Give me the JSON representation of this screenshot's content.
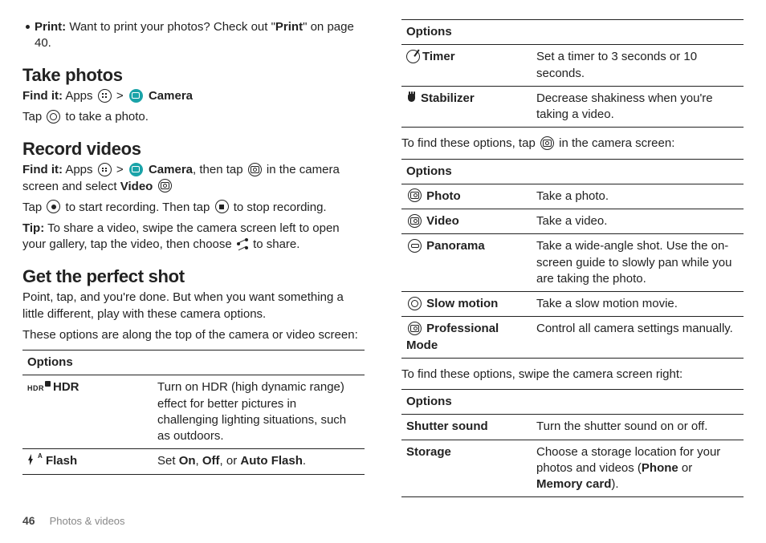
{
  "left": {
    "print_line_a": "Print:",
    "print_line_b": " Want to print your photos? Check out \"",
    "print_link": "Print",
    "print_line_c": "\" on page 40.",
    "h_take": "Take photos",
    "findit": "Find it:",
    "apps_word": " Apps ",
    "gt": " > ",
    "camera_word": " Camera",
    "tap_before": "Tap ",
    "tap_after": " to take a photo.",
    "h_record": "Record videos",
    "rec_after_cam": ", then tap ",
    "rec_tail": " in the camera screen and select ",
    "video_word": "Video",
    "rec_line2a": "Tap ",
    "rec_line2b": " to start recording. Then tap ",
    "rec_line2c": " to stop recording.",
    "tip_label": "Tip:",
    "tip_body": " To share a video, swipe the camera screen left to open your gallery, tap the video, then choose ",
    "tip_tail": " to share.",
    "h_perfect": "Get the perfect shot",
    "perfect_p1": "Point, tap, and you're done. But when you want something a little different, play with these camera options.",
    "perfect_p2": "These options are along the top of the camera or video screen:",
    "t1_header": "Options",
    "t1_r1_name": "HDR",
    "t1_r1_desc": "Turn on HDR (high dynamic range) effect for better pictures in challenging lighting situations, such as outdoors.",
    "t1_r2_name": "Flash",
    "t1_r2_desc_a": "Set ",
    "t1_r2_on": "On",
    "t1_r2_sep1": ", ",
    "t1_r2_off": "Off",
    "t1_r2_sep2": ", or ",
    "t1_r2_auto": "Auto Flash",
    "t1_r2_dot": "."
  },
  "right": {
    "t0_header": "Options",
    "t0_r1_name": "Timer",
    "t0_r1_desc": "Set a timer to 3 seconds or 10 seconds.",
    "t0_r2_name": "Stabilizer",
    "t0_r2_desc": "Decrease shakiness when you're taking a video.",
    "find_opts_a": "To find these options, tap ",
    "find_opts_b": " in the camera screen:",
    "t2_header": "Options",
    "t2_r1_name": "Photo",
    "t2_r1_desc": "Take a photo.",
    "t2_r2_name": "Video",
    "t2_r2_desc": "Take a video.",
    "t2_r3_name": "Panorama",
    "t2_r3_desc": "Take a wide-angle shot. Use the on-screen guide to slowly pan while you are taking the photo.",
    "t2_r4_name": "Slow motion",
    "t2_r4_desc": "Take a slow motion movie.",
    "t2_r5_name": "Professional Mode",
    "t2_r5_desc": "Control all camera settings manually.",
    "swipe_right": "To find these options, swipe the camera screen right:",
    "t3_header": "Options",
    "t3_r1_name": "Shutter sound",
    "t3_r1_desc": "Turn the shutter sound on or off.",
    "t3_r2_name": "Storage",
    "t3_r2_desc_a": "Choose a storage location for your photos and videos (",
    "t3_r2_phone": "Phone",
    "t3_r2_or": " or ",
    "t3_r2_mem": "Memory card",
    "t3_r2_tail": ")."
  },
  "footer": {
    "page": "46",
    "section": "Photos & videos"
  }
}
